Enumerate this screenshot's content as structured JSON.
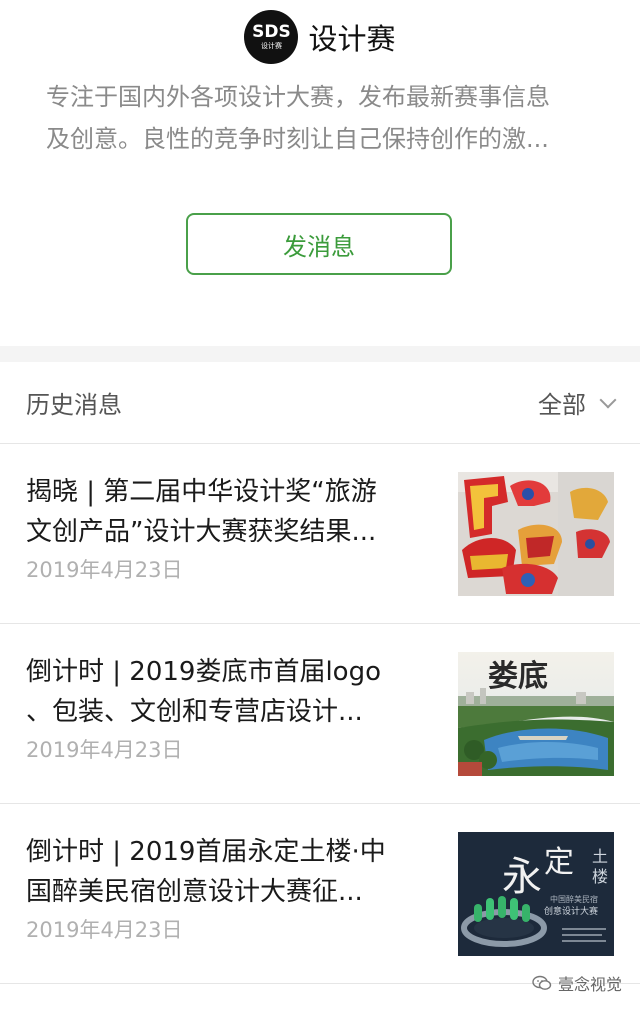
{
  "account": {
    "logo_text": "SDS",
    "logo_sub": "设计赛",
    "name": "设计赛",
    "description_line1": "专注于国内外各项设计大赛，发布最新赛事信息",
    "description_line2": "及创意。良性的竞争时刻让自己保持创作的激...",
    "send_message_label": "发消息"
  },
  "history": {
    "title": "历史消息",
    "filter_label": "全部"
  },
  "articles": [
    {
      "title_line1": "揭晓 | 第二届中华设计奖“旅游",
      "title_line2": "文创产品”设计大赛获奖结果...",
      "date": "2019年4月23日"
    },
    {
      "title_line1": "倒计时 | 2019娄底市首届logo",
      "title_line2": "、包装、文创和专营店设计...",
      "date": "2019年4月23日"
    },
    {
      "title_line1": "倒计时 | 2019首届永定土楼·中",
      "title_line2": "国醉美民宿创意设计大赛征...",
      "date": "2019年4月23日"
    }
  ],
  "thumbs": {
    "third_title_a": "永",
    "third_title_b": "定",
    "third_title_c": "土",
    "third_title_d": "楼",
    "third_sub1": "中国醉美民宿",
    "third_sub2": "创意设计大赛",
    "second_callig": "娄底"
  },
  "watermark": {
    "text": "壹念视觉"
  },
  "colors": {
    "accent_green": "#3b9b3b",
    "muted_text": "#8a8a8a",
    "date_text": "#b0b0b0"
  }
}
